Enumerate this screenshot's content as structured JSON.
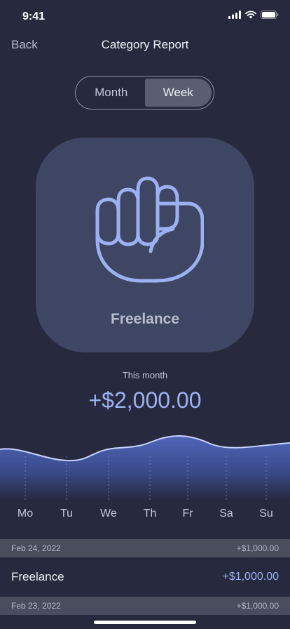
{
  "status_bar": {
    "time": "9:41"
  },
  "nav": {
    "back_label": "Back",
    "title": "Category Report"
  },
  "segmented": {
    "options": [
      "Month",
      "Week"
    ],
    "selected": "Week"
  },
  "category": {
    "name": "Freelance",
    "icon": "fist-icon"
  },
  "summary": {
    "period_label": "This month",
    "amount": "+$2,000.00"
  },
  "chart_data": {
    "type": "area",
    "categories": [
      "Mo",
      "Tu",
      "We",
      "Th",
      "Fr",
      "Sa",
      "Su"
    ],
    "color": "#4f66b8"
  },
  "transactions": [
    {
      "date": "Feb 24, 2022",
      "date_total": "+$1,000.00",
      "items": [
        {
          "name": "Freelance",
          "amount": "+$1,000.00"
        }
      ]
    },
    {
      "date": "Feb 23, 2022",
      "date_total": "+$1,000.00",
      "items": []
    }
  ],
  "colors": {
    "background": "#272a3e",
    "card": "#3f4663",
    "accent": "#9cb1f2"
  }
}
